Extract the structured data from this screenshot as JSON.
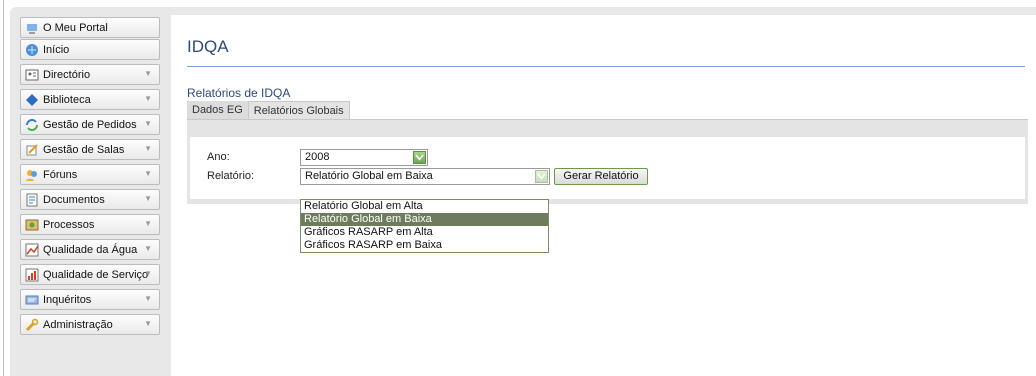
{
  "sidebar": {
    "items": [
      {
        "label": "O Meu Portal",
        "icon": "portal-icon",
        "has_arrow": false
      },
      {
        "label": "Início",
        "icon": "home-icon",
        "has_arrow": false
      },
      {
        "label": "Directório",
        "icon": "directory-icon",
        "has_arrow": true
      },
      {
        "label": "Biblioteca",
        "icon": "book-icon",
        "has_arrow": true
      },
      {
        "label": "Gestão de Pedidos",
        "icon": "requests-icon",
        "has_arrow": true
      },
      {
        "label": "Gestão de Salas",
        "icon": "rooms-icon",
        "has_arrow": true
      },
      {
        "label": "Fóruns",
        "icon": "forums-icon",
        "has_arrow": true
      },
      {
        "label": "Documentos",
        "icon": "documents-icon",
        "has_arrow": true
      },
      {
        "label": "Processos",
        "icon": "processes-icon",
        "has_arrow": true
      },
      {
        "label": "Qualidade da Água",
        "icon": "water-quality-icon",
        "has_arrow": true
      },
      {
        "label": "Qualidade de Serviço",
        "icon": "service-quality-icon",
        "has_arrow": true
      },
      {
        "label": "Inquéritos",
        "icon": "surveys-icon",
        "has_arrow": true
      },
      {
        "label": "Administração",
        "icon": "admin-icon",
        "has_arrow": true
      }
    ]
  },
  "main": {
    "title": "IDQA",
    "subtitle": "Relatórios de IDQA",
    "tabs": [
      {
        "label": "Dados EG",
        "active": false
      },
      {
        "label": "Relatórios Globais",
        "active": true
      }
    ],
    "form": {
      "ano_label": "Ano:",
      "ano_value": "2008",
      "relatorio_label": "Relatório:",
      "relatorio_value": "Relatório Global em Baixa",
      "generate_button": "Gerar Relatório",
      "relatorio_options": [
        "Relatório Global em Alta",
        "Relatório Global em Baixa",
        "Gráficos RASARP em Alta",
        "Gráficos RASARP em Baixa"
      ],
      "selected_option_index": 1
    }
  },
  "colors": {
    "title": "#2b4a7a",
    "accent_green": "#6aa84f",
    "selected_option_bg": "#6d7d5c",
    "frame_bg": "#e8e8e8"
  }
}
